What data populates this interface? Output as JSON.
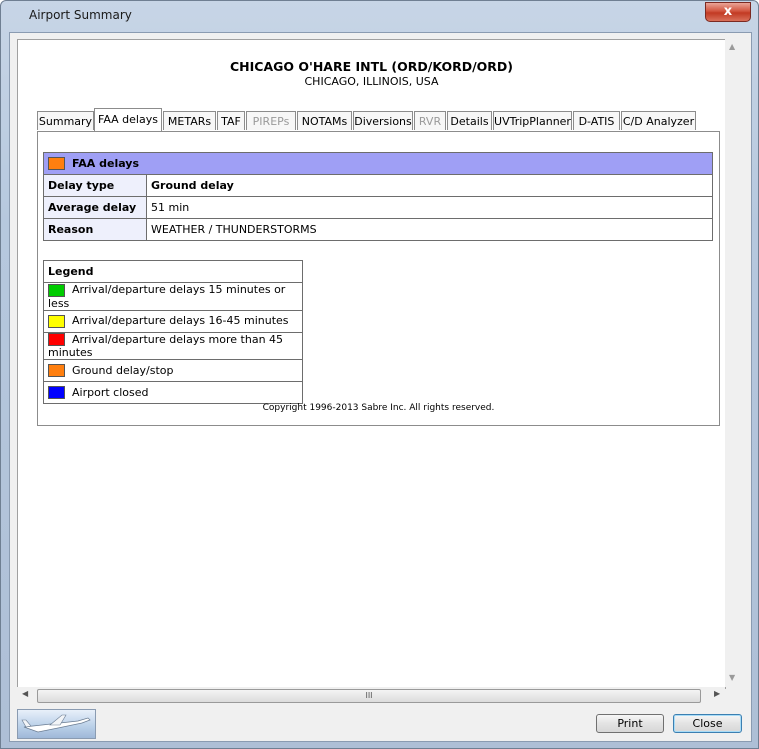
{
  "window": {
    "title": "Airport Summary",
    "close_glyph": "x"
  },
  "airport": {
    "name": "CHICAGO O'HARE INTL (ORD/KORD/ORD)",
    "location": "CHICAGO, ILLINOIS, USA"
  },
  "tabs": [
    {
      "label": "Summary",
      "state": "normal"
    },
    {
      "label": "FAA delays",
      "state": "active"
    },
    {
      "label": "METARs",
      "state": "normal"
    },
    {
      "label": "TAF",
      "state": "normal"
    },
    {
      "label": "PIREPs",
      "state": "disabled"
    },
    {
      "label": "NOTAMs",
      "state": "normal"
    },
    {
      "label": "Diversions",
      "state": "normal"
    },
    {
      "label": "RVR",
      "state": "disabled"
    },
    {
      "label": "Details",
      "state": "normal"
    },
    {
      "label": "UVTripPlanner",
      "state": "normal"
    },
    {
      "label": "D-ATIS",
      "state": "normal"
    },
    {
      "label": "C/D Analyzer",
      "state": "normal"
    }
  ],
  "faa": {
    "header": "FAA delays",
    "header_color": "#ff7f0f",
    "rows": [
      {
        "label": "Delay type",
        "value": "Ground delay"
      },
      {
        "label": "Average delay",
        "value": "51 min"
      },
      {
        "label": "Reason",
        "value": "WEATHER / THUNDERSTORMS"
      }
    ]
  },
  "legend": {
    "title": "Legend",
    "items": [
      {
        "color": "#00cc00",
        "label": "Arrival/departure delays 15 minutes or less"
      },
      {
        "color": "#ffff00",
        "label": "Arrival/departure delays 16-45 minutes"
      },
      {
        "color": "#ff0000",
        "label": "Arrival/departure delays more than 45 minutes"
      },
      {
        "color": "#ff7f0f",
        "label": "Ground delay/stop"
      },
      {
        "color": "#0000ff",
        "label": "Airport closed"
      }
    ]
  },
  "copyright": "Copyright 1996-2013 Sabre Inc. All rights reserved.",
  "buttons": {
    "print": "Print",
    "close": "Close"
  },
  "scroll": {
    "thumb_glyph": "III"
  }
}
